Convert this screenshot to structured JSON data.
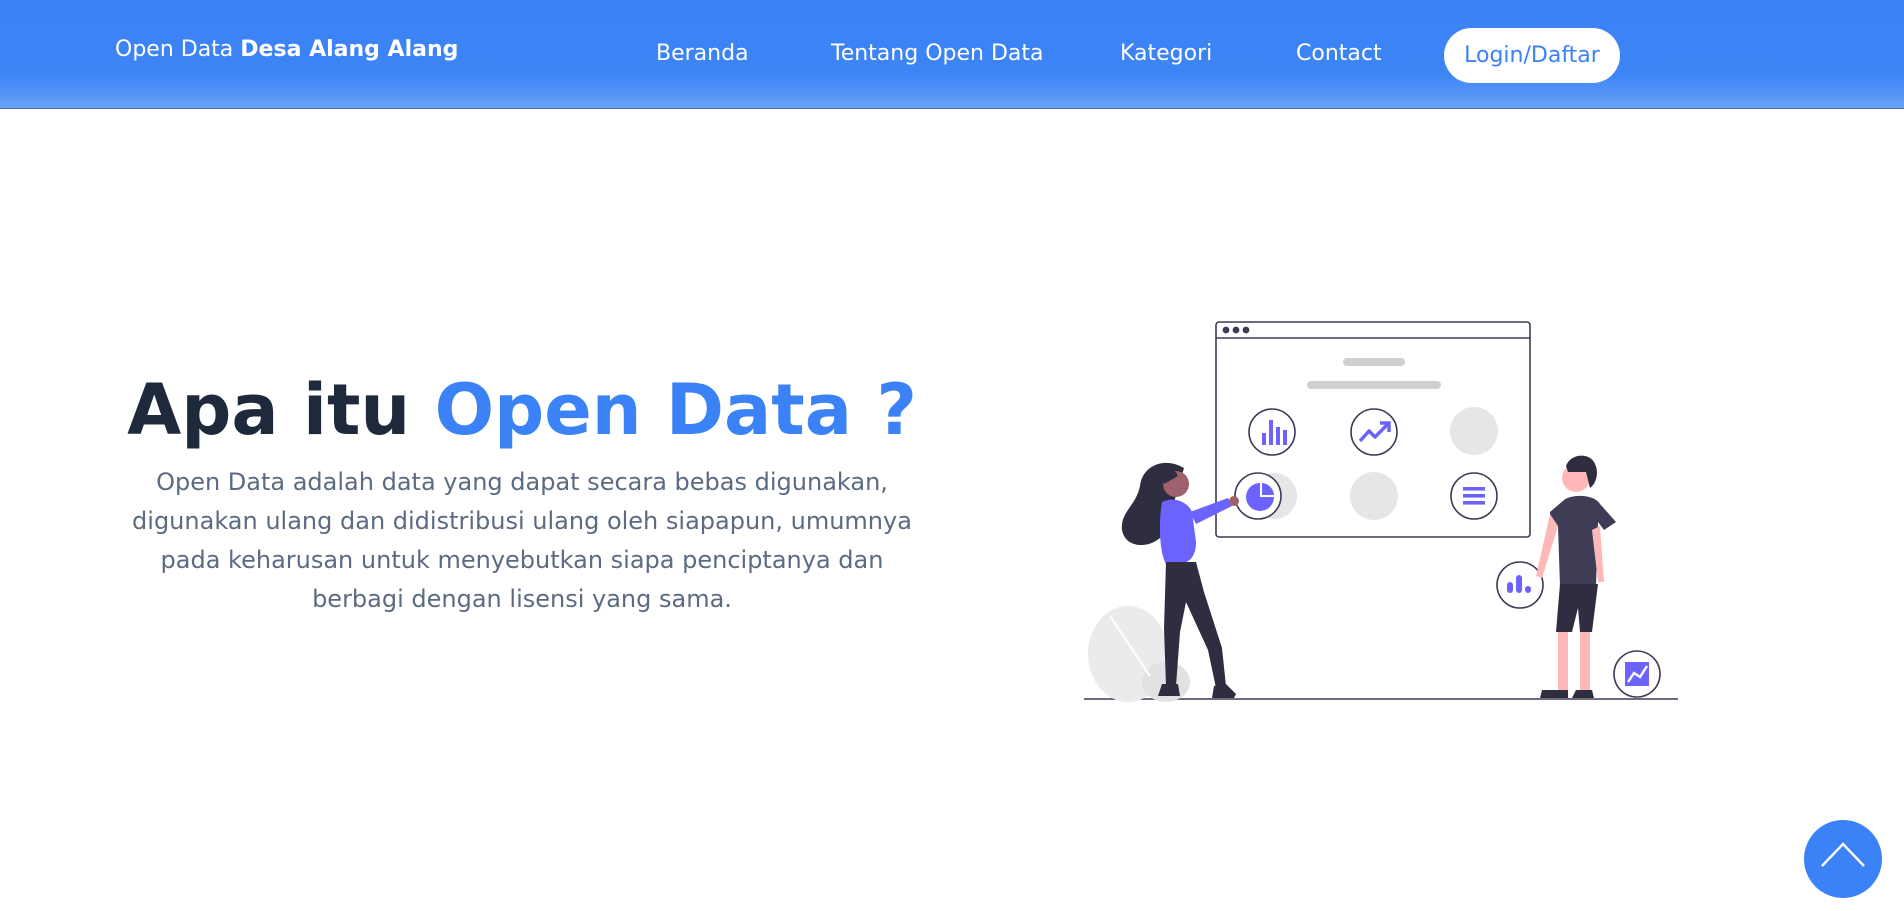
{
  "header": {
    "brand_prefix": "Open Data",
    "brand_name": "Desa Alang Alang",
    "nav": {
      "beranda": "Beranda",
      "tentang": "Tentang Open Data",
      "kategori": "Kategori",
      "contact": "Contact"
    },
    "login_label": "Login/Daftar"
  },
  "hero": {
    "title_part1": "Apa itu",
    "title_accent": "Open Data ?",
    "description": "Open Data adalah data yang dapat secara bebas digunakan, digunakan ulang dan didistribusi ulang oleh siapapun, umumnya pada keharusan untuk menyebutkan siapa penciptanya dan berbagi dengan lisensi yang sama."
  },
  "illustration": {
    "subject": "two people viewing data dashboard",
    "icons": [
      "bar-chart-icon",
      "trend-icon",
      "pie-chart-icon",
      "list-icon",
      "dots-chart-icon",
      "area-chart-icon"
    ]
  },
  "scroll_top": {
    "icon": "chevron-up-icon"
  },
  "colors": {
    "primary": "#3b82f6",
    "dark_text": "#1e293b",
    "muted_text": "#5b6b82",
    "illustration_accent": "#6c63ff"
  }
}
